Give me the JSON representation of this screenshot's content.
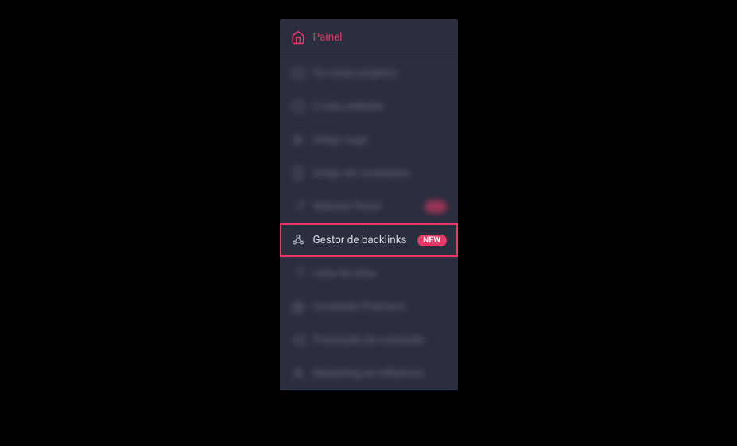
{
  "sidebar": {
    "panel": {
      "label": "Painel"
    },
    "items": [
      {
        "label": "Os meus projetos",
        "hasChevron": false,
        "hasBadge": false
      },
      {
        "label": "O meu website",
        "hasChevron": true,
        "hasBadge": false
      },
      {
        "label": "Artigo sugs",
        "hasChevron": true,
        "hasBadge": false
      },
      {
        "label": "Artigo de conteúdos",
        "hasChevron": true,
        "hasBadge": false
      },
      {
        "label": "Website Panel",
        "hasChevron": false,
        "hasBadge": true
      }
    ],
    "highlighted": {
      "label": "Gestor de backlinks",
      "badge": "NEW"
    },
    "items2": [
      {
        "label": "Lista de sites",
        "hasChevron": true
      },
      {
        "label": "Conteúdo Premium",
        "hasChevron": true
      },
      {
        "label": "Promoção de conteúdo",
        "hasChevron": false
      },
      {
        "label": "Marketing de influência",
        "hasChevron": false
      }
    ]
  }
}
